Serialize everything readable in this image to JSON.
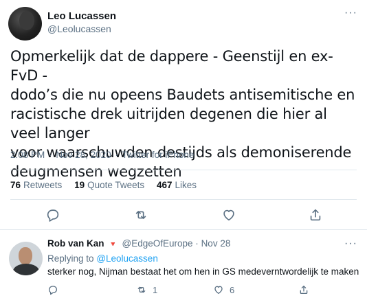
{
  "tweet": {
    "author_name": "Leo Lucassen",
    "author_handle": "@Leolucassen",
    "more_label": "···",
    "lines": [
      "Opmerkelijk dat de dappere - Geenstijl en ex-FvD -",
      "dodo’s die nu opeens Baudets antisemitische en",
      "racistische drek uitrijden degenen die hier al veel langer",
      "voor waarschuwden destijds als demoniserende",
      "deugmensen wegzetten"
    ],
    "time": "2:08 PM",
    "sep": "·",
    "date": "Nov 28, 2020",
    "source": "Twitter for iPhone"
  },
  "stats": {
    "retweets_count": "76",
    "retweets_label": "Retweets",
    "quotes_count": "19",
    "quotes_label": "Quote Tweets",
    "likes_count": "467",
    "likes_label": "Likes"
  },
  "actions": {
    "icons": [
      "reply-icon",
      "retweet-icon",
      "like-icon",
      "share-icon"
    ]
  },
  "reply": {
    "author_name": "Rob van Kan",
    "badge": "🔻",
    "author_handle": "@EdgeOfEurope",
    "sep": "·",
    "date": "Nov 28",
    "more_label": "···",
    "replying_prefix": "Replying to",
    "replying_to": "@Leolucassen",
    "text": "sterker nog, Nijman bestaat het om hen in GS medeverntwordelijk te maken",
    "reply_count": "",
    "retweet_count": "1",
    "like_count": "6"
  },
  "colors": {
    "text": "#0f1419",
    "secondary": "#5b7083",
    "link": "#1da1f2",
    "divider": "#e1e8ed",
    "badge": "#e0245e"
  }
}
